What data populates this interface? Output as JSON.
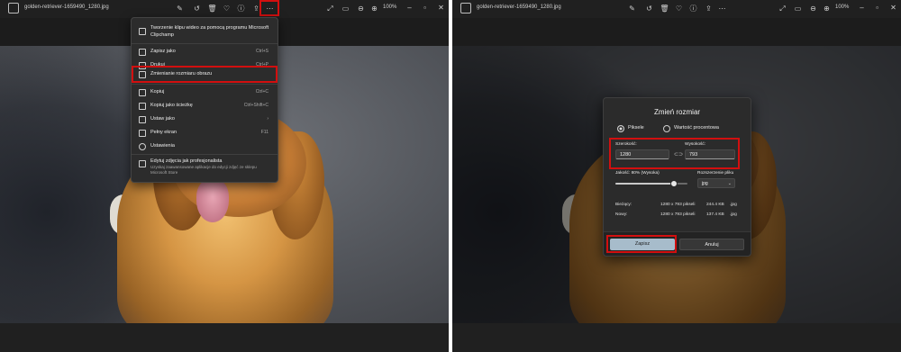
{
  "colors": {
    "highlight": "#d20f0f",
    "window_bg": "#1c1c1c",
    "menu_bg": "#2c2c2c",
    "primary_button": "#a7bccb"
  },
  "left": {
    "title": "golden-retriever-1659490_1280.jpg",
    "zoom": "100%",
    "toolbar_icons": [
      "edit-icon",
      "rotate-icon",
      "delete-icon",
      "favorite-icon",
      "info-icon",
      "share-icon",
      "more-icon"
    ],
    "view_icons": [
      "expand-icon",
      "fit-icon",
      "zoom-out-icon"
    ],
    "menu": {
      "clipchamp_line1": "Tworzenie klipu wideo za pomocą programu Microsoft",
      "clipchamp_line2": "Clipchamp",
      "save_as": "Zapisz jako",
      "save_as_sc": "Ctrl+S",
      "print": "Drukuj",
      "print_sc": "Ctrl+P",
      "resize": "Zmienianie rozmiaru obrazu",
      "copy": "Kopiuj",
      "copy_sc": "Ctrl+C",
      "copy_path": "Kopiuj jako ścieżkę",
      "copy_path_sc": "Ctrl+Shift+C",
      "set_as": "Ustaw jako",
      "set_as_arrow": "›",
      "fullscreen": "Pełny ekran",
      "fullscreen_sc": "F11",
      "settings": "Ustawienia",
      "pro_title": "Edytuj zdjęcia jak profesjonalista",
      "pro_sub1": "Uzyskaj zaawansowane aplikacje do edycji zdjęć ze sklepu",
      "pro_sub2": "Microsoft Store"
    }
  },
  "right": {
    "title": "golden-retriever-1659490_1280.jpg",
    "zoom": "100%",
    "dialog": {
      "title": "Zmień rozmiar",
      "radio_pixels": "Piksele",
      "radio_percent": "Wartość procentowa",
      "width_label": "Szerokość:",
      "height_label": "Wysokość:",
      "width_value": "1280",
      "height_value": "793",
      "quality_label": "Jakość: 80% (Wysoka)",
      "quality_percent": 80,
      "ext_label": "Rozszerzenie pliku",
      "ext_value": "jpg",
      "current_label": "Bieżący:",
      "current_dims": "1280 x 793 pikseli",
      "current_size": "244.4 KB",
      "current_ext": ".jpg",
      "new_label": "Nowy:",
      "new_dims": "1280 x 793 pikseli",
      "new_size": "137.4 KB",
      "new_ext": ".jpg",
      "save": "Zapisz",
      "cancel": "Anuluj"
    }
  }
}
